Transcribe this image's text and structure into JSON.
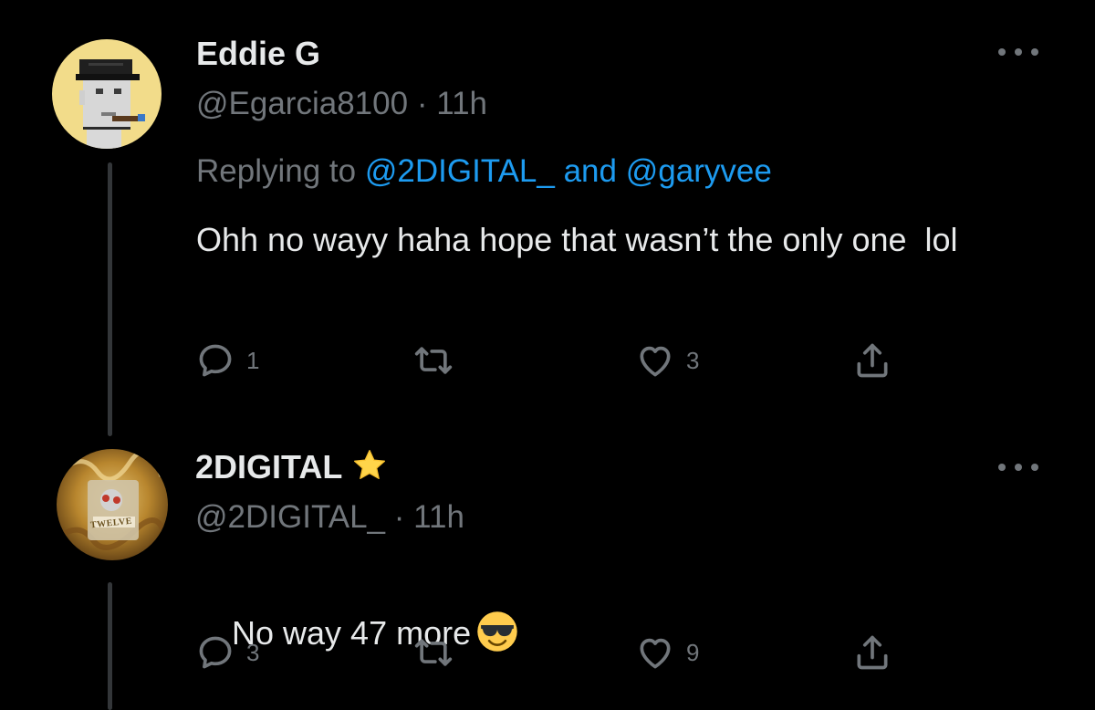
{
  "tweets": [
    {
      "name": "Eddie G",
      "handle": "@Egarcia8100",
      "separator": "·",
      "time": "11h",
      "replying_prefix": "Replying to",
      "replying_mention_1": "@2DIGITAL_",
      "replying_and": "and",
      "replying_mention_2": "@garyvee",
      "text": "Ohh no wayy haha hope that wasn’t the only one  lol",
      "replies": "1",
      "retweets": "",
      "likes": "3",
      "avatar_icon": "punk-avatar-icon"
    },
    {
      "name": "2DIGITAL",
      "name_badge_icon": "star-icon",
      "handle": "@2DIGITAL_",
      "separator": "·",
      "time": "11h",
      "text": "No way 47 more",
      "text_emoji_icon": "sunglasses-emoji-icon",
      "replies": "3",
      "retweets": "",
      "likes": "9",
      "avatar_text": "TWELVE"
    }
  ],
  "colors": {
    "background": "#000000",
    "text": "#e7e9ea",
    "muted": "#71767b",
    "link": "#1d9bf0",
    "thread_line": "#333639"
  }
}
